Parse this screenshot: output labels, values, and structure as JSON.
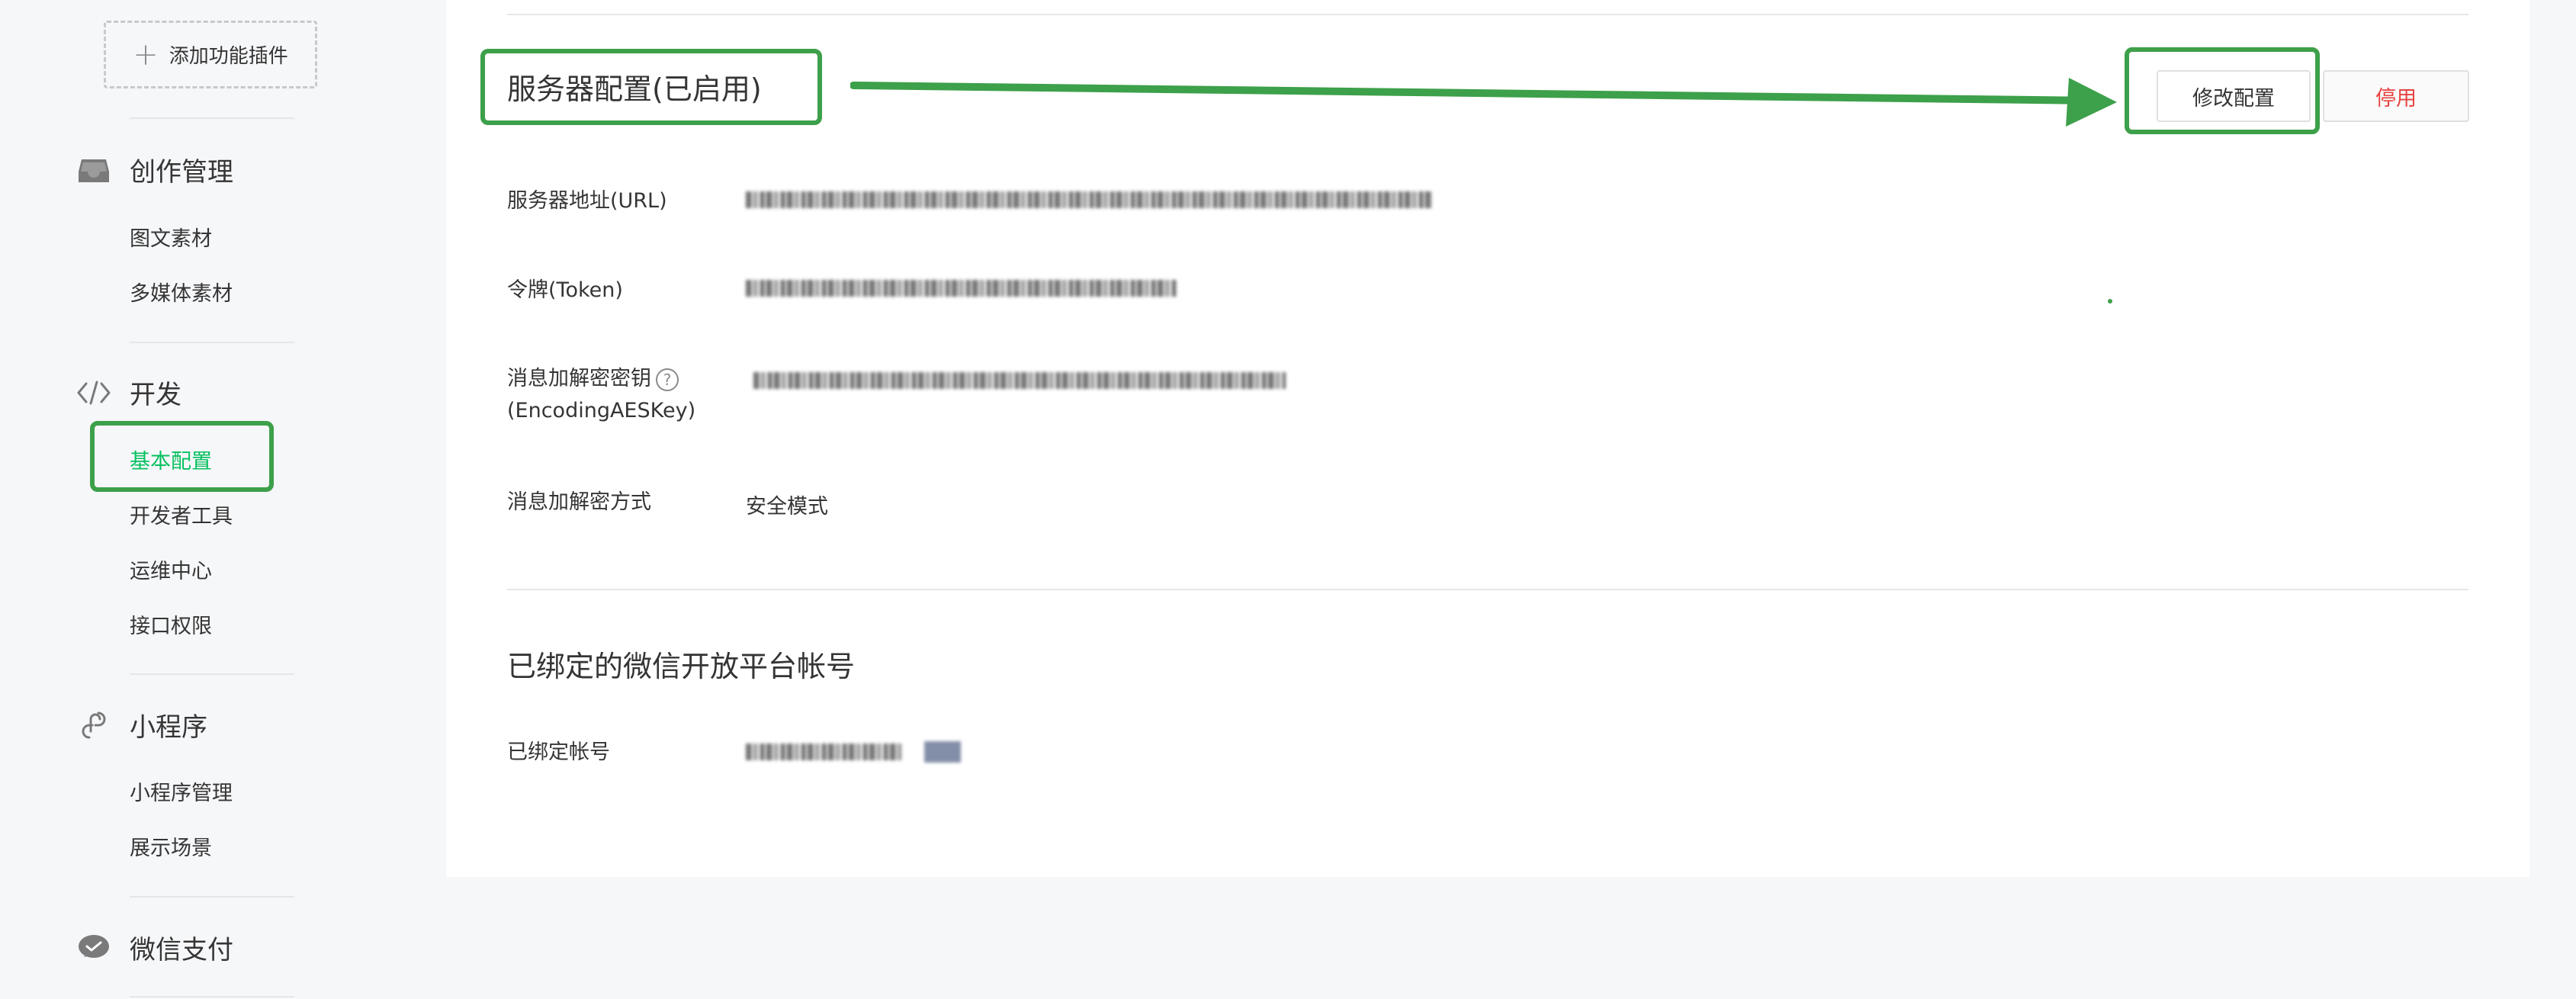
{
  "sidebar": {
    "add_plugin_label": "添加功能插件",
    "categories": [
      {
        "label": "创作管理",
        "icon": "inbox-icon",
        "items": [
          "图文素材",
          "多媒体素材"
        ]
      },
      {
        "label": "开发",
        "icon": "code-icon",
        "items": [
          "基本配置",
          "开发者工具",
          "运维中心",
          "接口权限"
        ],
        "active_item": "基本配置"
      },
      {
        "label": "小程序",
        "icon": "link-icon",
        "items": [
          "小程序管理",
          "展示场景"
        ]
      },
      {
        "label": "微信支付",
        "icon": "wechat-pay-icon",
        "items": []
      }
    ]
  },
  "server_config": {
    "title": "服务器配置(已启用)",
    "modify_button": "修改配置",
    "disable_button": "停用",
    "fields": [
      {
        "label": "服务器地址(URL)",
        "value_obscured": true
      },
      {
        "label": "令牌(Token)",
        "value_obscured": true
      },
      {
        "label_line1": "消息加解密密钥",
        "label_line2": "(EncodingAESKey)",
        "help_icon": "question-circle-icon",
        "help_glyph": "?",
        "value_obscured": true
      },
      {
        "label": "消息加解密方式",
        "value": "安全模式"
      }
    ]
  },
  "open_platform": {
    "title": "已绑定的微信开放平台帐号",
    "field_label": "已绑定帐号",
    "value_obscured": true
  },
  "annotation": {
    "color": "#3da04a"
  }
}
